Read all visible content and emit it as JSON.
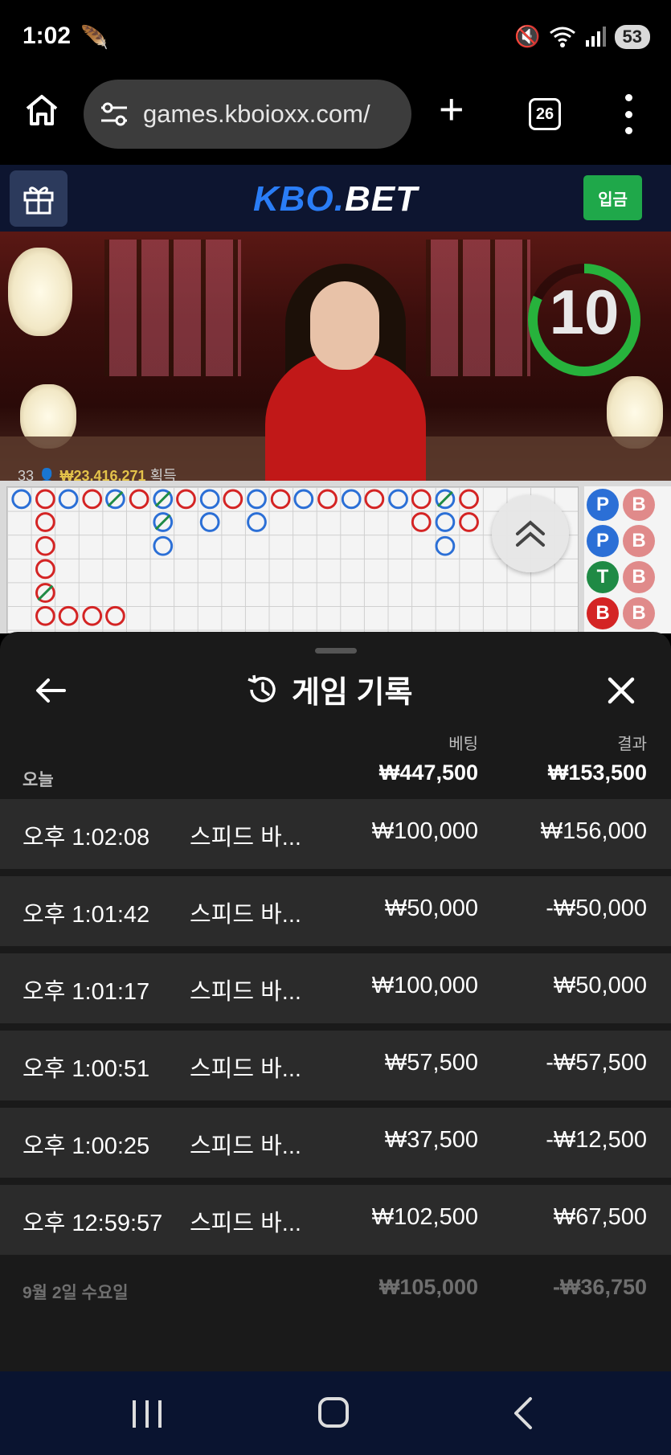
{
  "status_bar": {
    "time": "1:02",
    "battery": "53"
  },
  "browser": {
    "url": "games.kboioxx.com/",
    "tab_count": "26"
  },
  "site": {
    "logo_prefix": "KBO.",
    "logo_suffix": "BET",
    "deposit_label": "입금"
  },
  "video": {
    "countdown": "10",
    "player_count": "33",
    "win_amount": "₩23,416,271",
    "win_label": "획득"
  },
  "roadmap": {
    "predictions": [
      "P",
      "P",
      "T",
      "B"
    ],
    "banker_label": "B"
  },
  "history": {
    "title": "게임 기록",
    "col_bet": "베팅",
    "col_result": "결과",
    "today_label": "오늘",
    "today_bet": "₩447,500",
    "today_result": "₩153,500",
    "rows": [
      {
        "time": "오후 1:02:08",
        "game": "스피드 바...",
        "bet": "₩100,000",
        "result": "₩156,000"
      },
      {
        "time": "오후 1:01:42",
        "game": "스피드 바...",
        "bet": "₩50,000",
        "result": "-₩50,000"
      },
      {
        "time": "오후 1:01:17",
        "game": "스피드 바...",
        "bet": "₩100,000",
        "result": "₩50,000"
      },
      {
        "time": "오후 1:00:51",
        "game": "스피드 바...",
        "bet": "₩57,500",
        "result": "-₩57,500"
      },
      {
        "time": "오후 1:00:25",
        "game": "스피드 바...",
        "bet": "₩37,500",
        "result": "-₩12,500"
      },
      {
        "time": "오후 12:59:57",
        "game": "스피드 바...",
        "bet": "₩102,500",
        "result": "₩67,500"
      }
    ],
    "prev_day_label": "9월 2일 수요일",
    "prev_day_bet": "₩105,000",
    "prev_day_result": "-₩36,750"
  },
  "colors": {
    "brand_blue": "#2a7df6",
    "deposit_green": "#1fa84a",
    "player_blue": "#2b6fd6",
    "banker_red": "#d42424",
    "tie_green": "#1f8a45"
  }
}
